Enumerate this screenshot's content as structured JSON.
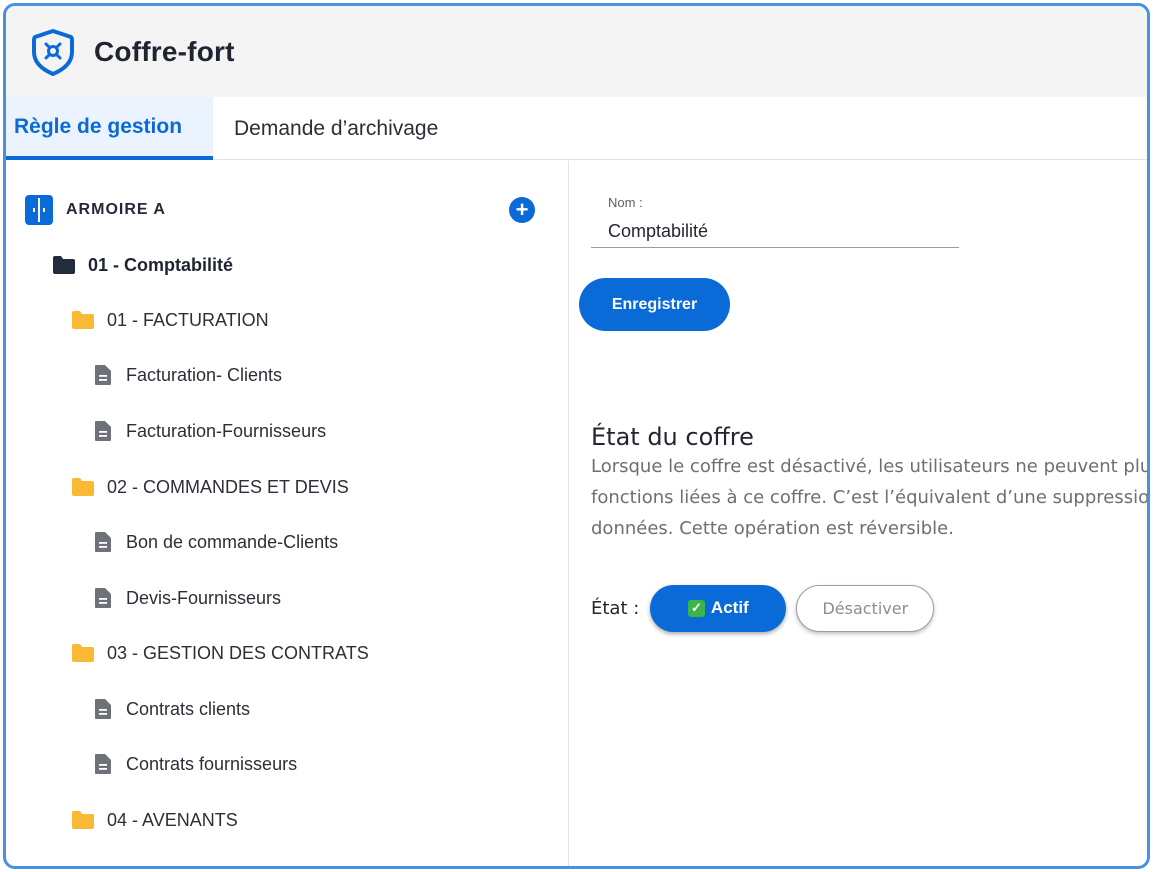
{
  "app": {
    "title": "Coffre-fort",
    "brand_color": "#0a6ad8"
  },
  "tabs": [
    {
      "label": "Règle de gestion",
      "active": true
    },
    {
      "label": "Demande d’archivage",
      "active": false
    }
  ],
  "tree": {
    "cabinet": {
      "label": "ARMOIRE A",
      "icon": "cabinet-icon",
      "add_icon": "plus-circle-icon"
    },
    "root_folder": {
      "label": "01 - Comptabilité",
      "icon": "folder-dark-icon"
    },
    "folders": [
      {
        "label": "01 - FACTURATION",
        "icon": "folder-icon",
        "docs": [
          "Facturation- Clients",
          "Facturation-Fournisseurs"
        ]
      },
      {
        "label": "02 - COMMANDES ET DEVIS",
        "icon": "folder-icon",
        "docs": [
          "Bon de commande-Clients",
          "Devis-Fournisseurs"
        ]
      },
      {
        "label": "03 - GESTION DES CONTRATS",
        "icon": "folder-icon",
        "docs": [
          "Contrats clients",
          "Contrats fournisseurs"
        ]
      },
      {
        "label": "04 - AVENANTS",
        "icon": "folder-icon",
        "docs": []
      }
    ],
    "doc_icon": "document-icon",
    "folder_color": "#f9b935"
  },
  "form": {
    "name_label": "Nom :",
    "name_value": "Comptabilité",
    "save_label": "Enregistrer"
  },
  "state_section": {
    "title": "État du coffre",
    "description_lines": [
      "Lorsque le coffre est désactivé, les utilisateurs ne peuvent plu",
      "fonctions liées à ce coffre. C’est l’équivalent d’une suppressio",
      "données. Cette opération est réversible."
    ],
    "state_label": "État :",
    "active_label": "Actif",
    "active_icon": "checkmark-icon",
    "deactivate_label": "Désactiver",
    "current_state": "Actif"
  }
}
